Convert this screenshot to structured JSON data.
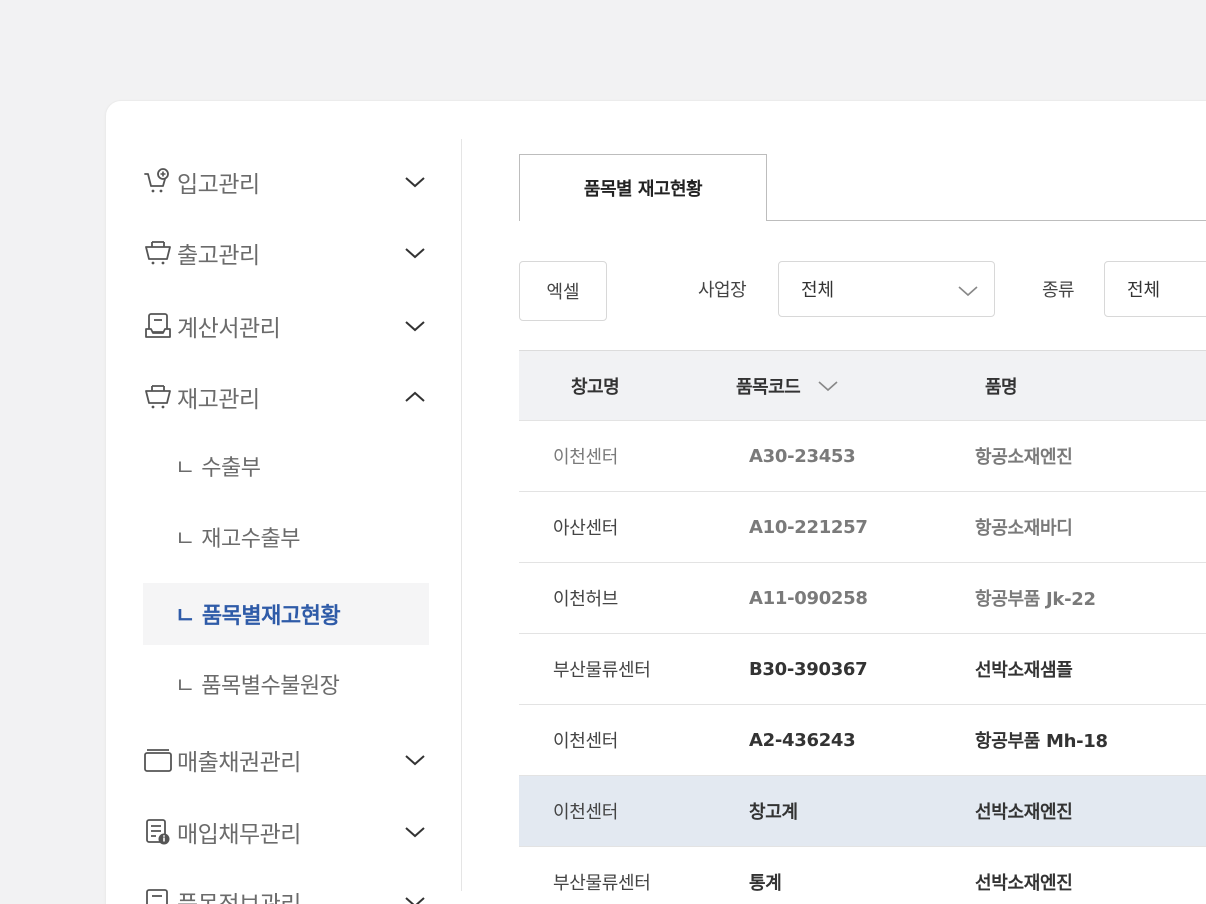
{
  "sidebar": {
    "items": [
      {
        "label": "입고관리",
        "icon": "cart-plus-icon",
        "expanded": false
      },
      {
        "label": "출고관리",
        "icon": "basket-icon",
        "expanded": false
      },
      {
        "label": "계산서관리",
        "icon": "invoice-tray-icon",
        "expanded": false
      },
      {
        "label": "재고관리",
        "icon": "basket-icon",
        "expanded": true
      },
      {
        "label": "매출채권관리",
        "icon": "card-icon",
        "expanded": false
      },
      {
        "label": "매입채무관리",
        "icon": "document-info-icon",
        "expanded": false
      },
      {
        "label": "품목정보관리",
        "icon": "document-icon",
        "expanded": false
      }
    ],
    "sub_items": [
      {
        "label": "ㄴ 수출부"
      },
      {
        "label": "ㄴ 재고수출부"
      },
      {
        "label": "ㄴ 품목별재고현황",
        "active": true
      },
      {
        "label": "ㄴ 품목별수불원장"
      }
    ]
  },
  "tabs": [
    {
      "label": "품목별 재고현황",
      "active": true
    }
  ],
  "toolbar": {
    "excel_label": "엑셀",
    "site_label": "사업장",
    "site_value": "전체",
    "kind_label": "종류",
    "kind_value": "전체"
  },
  "table": {
    "headers": [
      "창고명",
      "품목코드",
      "품명"
    ],
    "rows": [
      {
        "warehouse": "이천센터",
        "code": "A30-23453",
        "name": "항공소재엔진",
        "tone": "muted"
      },
      {
        "warehouse": "아산센터",
        "code": "A10-221257",
        "name": "항공소재바디",
        "tone": "muted"
      },
      {
        "warehouse": "이천허브",
        "code": "A11-090258",
        "name": "항공부품 Jk-22",
        "tone": "muted"
      },
      {
        "warehouse": "부산물류센터",
        "code": "B30-390367",
        "name": "선박소재샘플",
        "tone": "dark"
      },
      {
        "warehouse": "이천센터",
        "code": "A2-436243",
        "name": "항공부품 Mh-18",
        "tone": "dark"
      },
      {
        "warehouse": "이천센터",
        "code": "창고계",
        "name": "선박소재엔진",
        "tone": "dark",
        "selected": true
      },
      {
        "warehouse": "부산물류센터",
        "code": "통계",
        "name": "선박소재엔진",
        "tone": "dark"
      }
    ]
  },
  "colors": {
    "active_text": "#2f5ba8",
    "selected_row": "#e3e9f1",
    "header_bg": "#f1f2f4"
  }
}
